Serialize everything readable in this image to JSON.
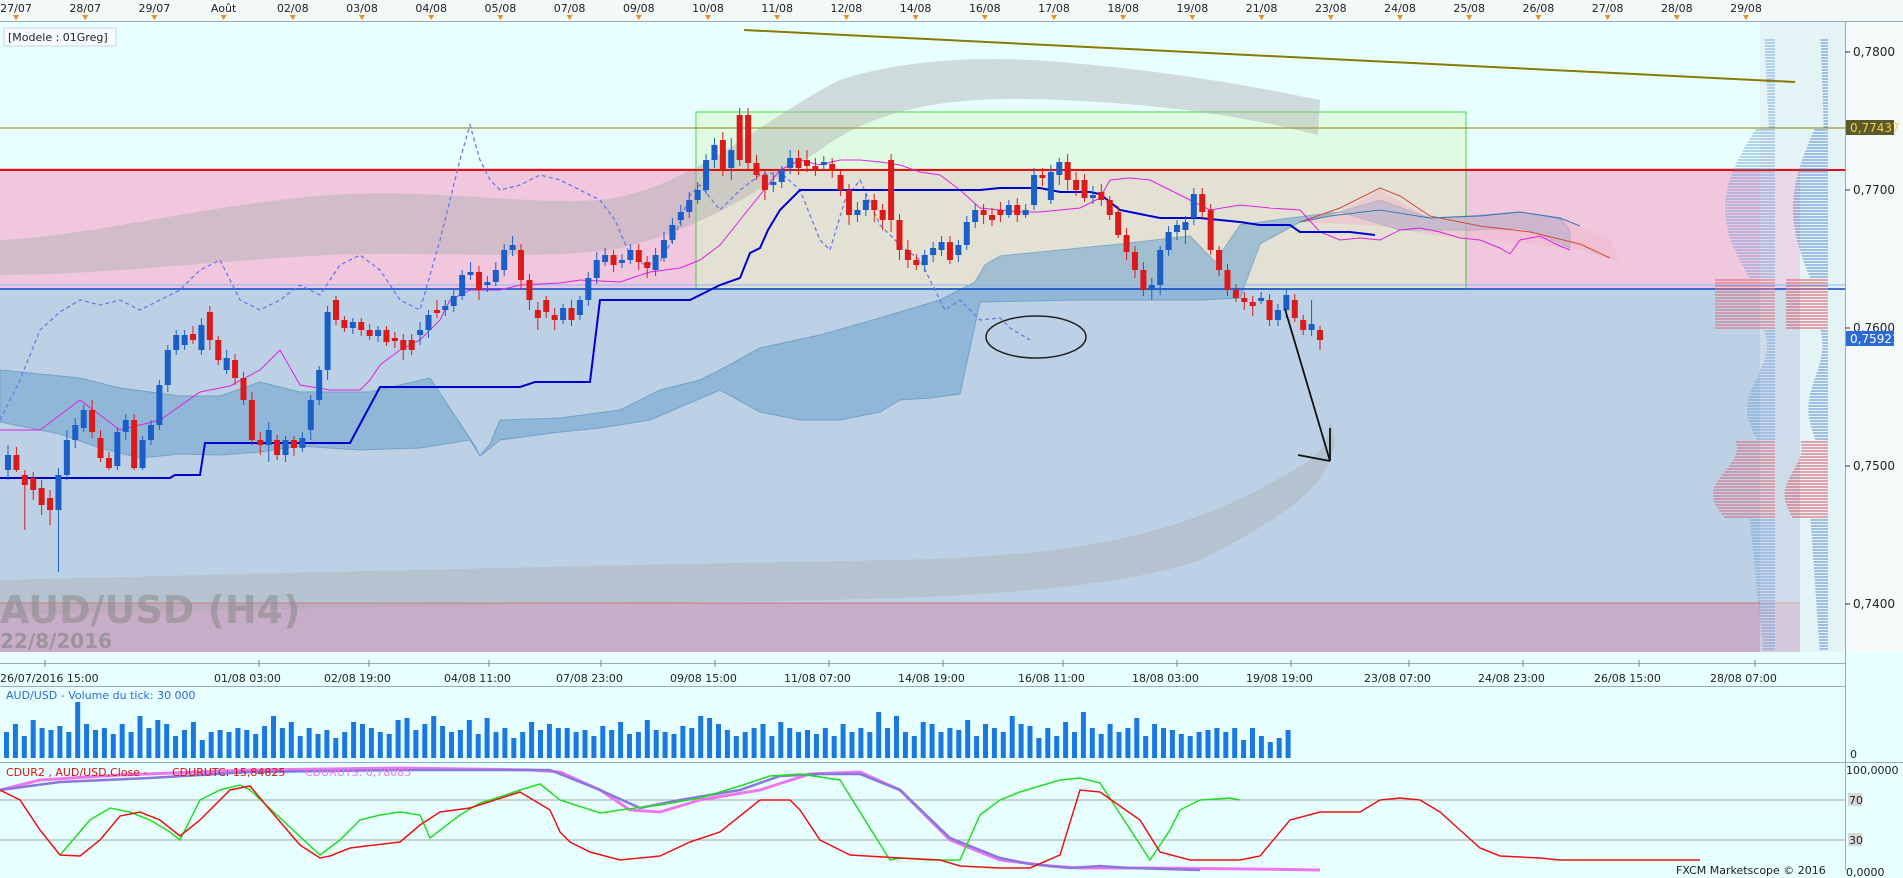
{
  "model_label": "[Modele : 01Greg]",
  "watermark": {
    "symbol": "AUD/USD (H4)",
    "date": "22/8/2016"
  },
  "top_dates": [
    "27/07",
    "28/07",
    "29/07",
    "Août",
    "02/08",
    "03/08",
    "04/08",
    "05/08",
    "07/08",
    "09/08",
    "10/08",
    "11/08",
    "12/08",
    "14/08",
    "16/08",
    "17/08",
    "18/08",
    "19/08",
    "21/08",
    "23/08",
    "24/08",
    "25/08",
    "26/08",
    "27/08",
    "28/08",
    "29/08"
  ],
  "bottom_dates": [
    "26/07/2016 15:00",
    "01/08 03:00",
    "02/08 19:00",
    "04/08 11:00",
    "07/08 23:00",
    "09/08 15:00",
    "11/08 07:00",
    "14/08 19:00",
    "16/08 11:00",
    "18/08 03:00",
    "19/08 19:00",
    "23/08 07:00",
    "24/08 23:00",
    "26/08 15:00",
    "28/08 07:00"
  ],
  "price_axis": [
    "0,7800",
    "0,7700",
    "0,7600",
    "0,7500",
    "0,7400"
  ],
  "price_tags": {
    "resistance": "0,77437",
    "current": "0,75921"
  },
  "volume_panel": {
    "title": "AUD/USD - Volume du tick: 30 000",
    "zero_label": "0"
  },
  "indicator_panel": {
    "series_a": "CDUR2 , AUD/USD,Close -",
    "series_b": "CDURUTC: 15,84825",
    "series_c": "CDURUTS: 0,78085",
    "levels": [
      "100,0000",
      "70",
      "30",
      "0,0000"
    ]
  },
  "footer": "FXCM Marketscope © 2016",
  "colors": {
    "bull": "#1a5fc8",
    "bear": "#dd1a1a",
    "background": "#e8ffff",
    "kijun": "#0000cc",
    "tenkan": "#dd22dd",
    "chikou": "#6a7ae8",
    "osc_red": "#ee1111",
    "osc_green": "#22dd22",
    "osc_pink": "#ee77ee",
    "osc_purple": "#8877dd"
  }
}
